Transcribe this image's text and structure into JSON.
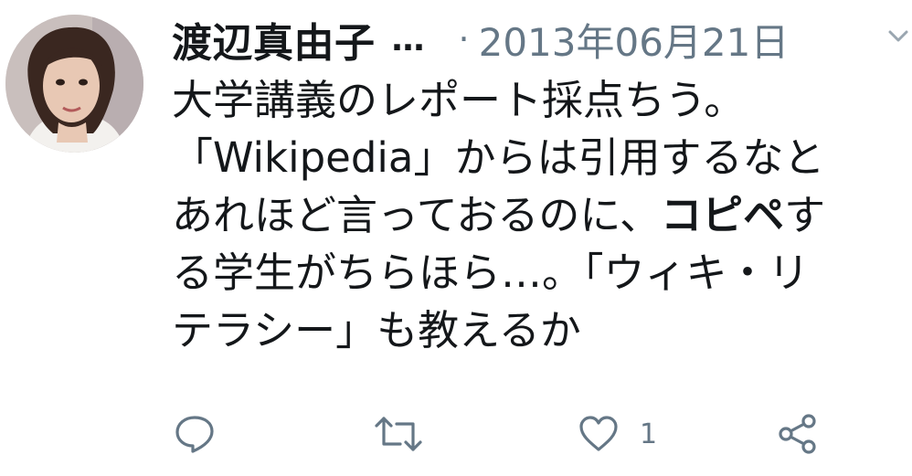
{
  "tweet": {
    "author_name": "渡辺真由子",
    "author_truncation": "…",
    "separator": "·",
    "date": "2013年06月21日",
    "body": {
      "line1": "大学講義のレポート採点ちう。",
      "line2": "「Wikipedia」からは引用するなと",
      "line3_start": "あれほど言っておるのに、",
      "line3_bold": "コピペ",
      "line3_end": "す",
      "line4": "る学生がちらほら…。「ウィキ・リ",
      "line5": "テラシー」も教えるか"
    }
  },
  "actions": {
    "reply_icon": "reply-icon",
    "retweet_icon": "retweet-icon",
    "like_icon": "heart-icon",
    "like_count": "1",
    "share_icon": "share-icon"
  },
  "colors": {
    "text": "#14171a",
    "secondary": "#657786"
  }
}
